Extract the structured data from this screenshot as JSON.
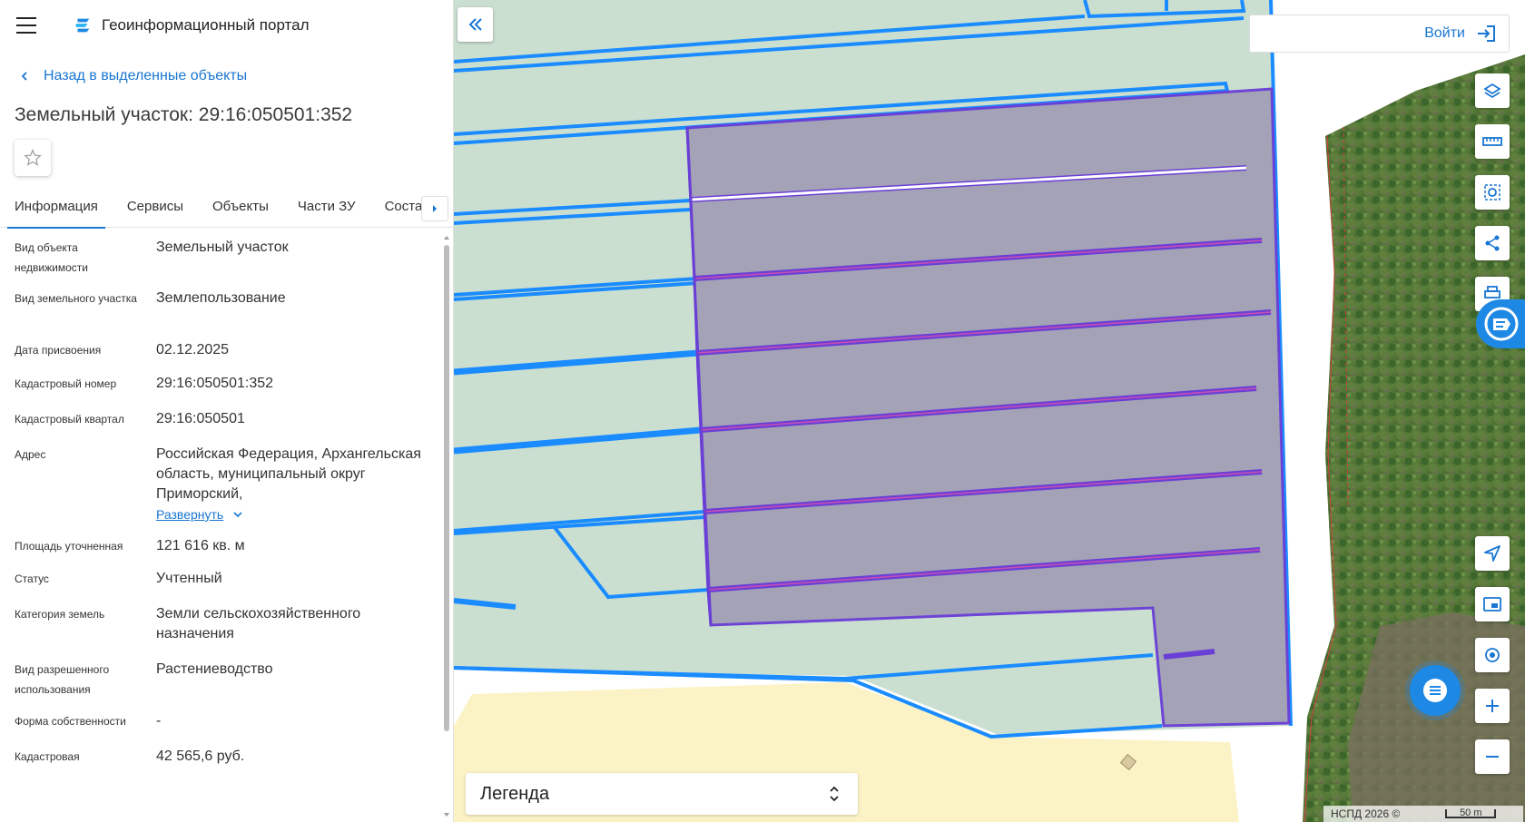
{
  "app": {
    "title": "Геоинформационный портал"
  },
  "nav": {
    "back_label": "Назад в выделенные объекты"
  },
  "object": {
    "title": "Земельный участок: 29:16:050501:352"
  },
  "tabs": [
    {
      "label": "Информация",
      "active": true
    },
    {
      "label": "Сервисы"
    },
    {
      "label": "Объекты"
    },
    {
      "label": "Части ЗУ"
    },
    {
      "label": "Состав"
    }
  ],
  "properties": [
    {
      "label": "Вид объекта недвижимости",
      "value": "Земельный участок"
    },
    {
      "label": "Вид земельного участка",
      "value": "Землепользование"
    },
    {
      "label": "Дата присвоения",
      "value": "02.12.2025"
    },
    {
      "label": "Кадастровый номер",
      "value": "29:16:050501:352"
    },
    {
      "label": "Кадастровый квартал",
      "value": "29:16:050501"
    },
    {
      "label": "Адрес",
      "value": "Российская Федерация, Архангельская область, муниципальный округ Приморский,"
    },
    {
      "label": "Площадь уточненная",
      "value": "121 616 кв. м"
    },
    {
      "label": "Статус",
      "value": "Учтенный"
    },
    {
      "label": "Категория земель",
      "value": "Земли сельскохозяйственного назначения"
    },
    {
      "label": "Вид разрешенного использования",
      "value": "Растениеводство"
    },
    {
      "label": "Форма собственности",
      "value": "-"
    },
    {
      "label": "Кадастровая",
      "value": "42 565,6 руб."
    }
  ],
  "address_expand_label": "Развернуть",
  "header": {
    "login_label": "Войти"
  },
  "legend": {
    "label": "Легенда"
  },
  "map": {
    "attribution": "НСПД 2026 ©",
    "scale_label": "50 m",
    "colors": {
      "parcel_fill": "#a3a1b6",
      "parcel_stroke": "#6a3fd6",
      "boundary": "#1a8cff",
      "field": "#cbdfd1",
      "zone": "#fbf3c6"
    }
  },
  "icons": {
    "menu": "menu-icon",
    "logo": "portal-logo-icon",
    "back": "chevron-left-icon",
    "favorite": "star-icon",
    "tabs_next": "chevron-right-icon",
    "collapse": "double-chevron-left-icon",
    "login": "login-icon",
    "layers": "layers-icon",
    "ruler": "ruler-icon",
    "select_area": "select-area-icon",
    "share": "share-icon",
    "print": "print-icon",
    "promo": "promo-icon",
    "locate": "navigation-icon",
    "minimap": "minimap-icon",
    "geolocation": "geolocation-icon",
    "zoom_in": "plus-icon",
    "zoom_out": "minus-icon",
    "chat": "chat-icon",
    "legend_toggle": "unfold-icon"
  }
}
